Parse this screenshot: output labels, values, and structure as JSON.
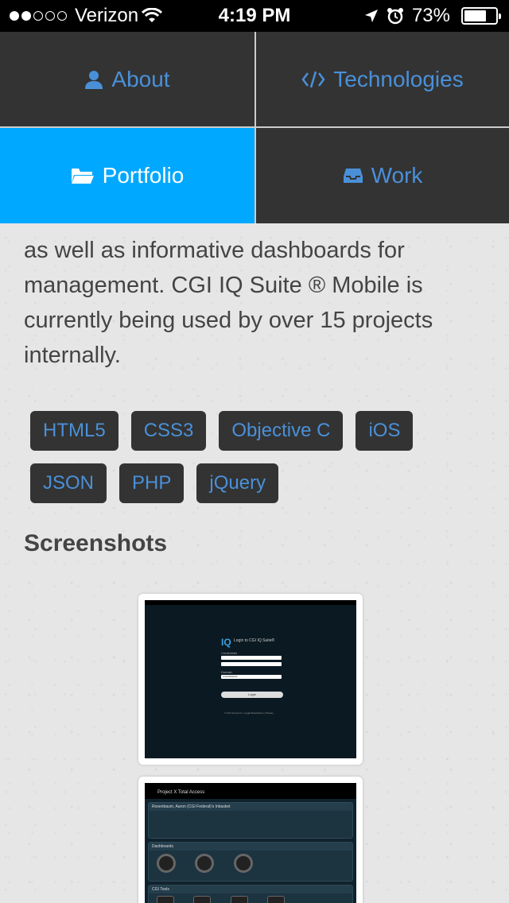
{
  "status_bar": {
    "carrier": "Verizon",
    "time": "4:19 PM",
    "battery_percent": "73%",
    "signal_bars_full": 2,
    "signal_bars_total": 5,
    "battery_level": 0.73
  },
  "nav": {
    "items": [
      {
        "label": "About",
        "icon": "user-icon",
        "active": false
      },
      {
        "label": "Technologies",
        "icon": "code-icon",
        "active": false
      },
      {
        "label": "Portfolio",
        "icon": "folder-open-icon",
        "active": true
      },
      {
        "label": "Work",
        "icon": "inbox-icon",
        "active": false
      }
    ],
    "active_color": "#00a8ff",
    "link_color": "#4a90d9"
  },
  "content": {
    "description": "as well as informative dashboards for management. CGI IQ Suite ® Mobile is currently being used by over 15 projects internally.",
    "tags": [
      "HTML5",
      "CSS3",
      "Objective C",
      "iOS",
      "JSON",
      "PHP",
      "jQuery"
    ],
    "screenshots_title": "Screenshots"
  },
  "screenshots": {
    "login": {
      "logo": "IQ",
      "title": "Login to CGI IQ Suite®",
      "credentials_label": "Credentials",
      "domain_label": "Domain",
      "domain_value": "CGIFEDERAL",
      "button": "Login",
      "footer": "© CGI Group Inc. | Legal Restrictions | Privacy"
    },
    "dashboard": {
      "header": "Project X Total Access",
      "panel1": "Rosenbaum, Aaron (CGI Federal)'s Inbasket",
      "panel2": "Dashboards",
      "panel3": "CGI Tools"
    }
  }
}
